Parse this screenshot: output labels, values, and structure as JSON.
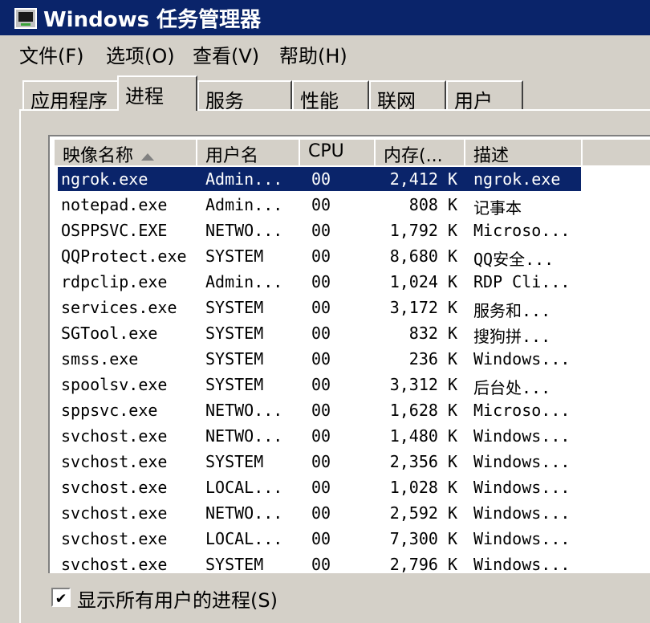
{
  "window": {
    "title": "Windows 任务管理器",
    "icon": "task-manager-icon"
  },
  "menu": [
    "文件(F)",
    "选项(O)",
    "查看(V)",
    "帮助(H)"
  ],
  "tabs": [
    {
      "label": "应用程序",
      "active": false
    },
    {
      "label": "进程",
      "active": true
    },
    {
      "label": "服务",
      "active": false
    },
    {
      "label": "性能",
      "active": false
    },
    {
      "label": "联网",
      "active": false
    },
    {
      "label": "用户",
      "active": false
    }
  ],
  "columns": [
    "映像名称",
    "用户名",
    "CPU",
    "内存(...",
    "描述"
  ],
  "sort_column": "映像名称",
  "processes": [
    {
      "name": "ngrok.exe",
      "user": "Admin...",
      "cpu": "00",
      "mem": "2,412 K",
      "desc": "ngrok.exe",
      "selected": true
    },
    {
      "name": "notepad.exe",
      "user": "Admin...",
      "cpu": "00",
      "mem": "808 K",
      "desc": "记事本"
    },
    {
      "name": "OSPPSVC.EXE",
      "user": "NETWO...",
      "cpu": "00",
      "mem": "1,792 K",
      "desc": "Microso..."
    },
    {
      "name": "QQProtect.exe",
      "user": "SYSTEM",
      "cpu": "00",
      "mem": "8,680 K",
      "desc": "QQ安全..."
    },
    {
      "name": "rdpclip.exe",
      "user": "Admin...",
      "cpu": "00",
      "mem": "1,024 K",
      "desc": "RDP Cli..."
    },
    {
      "name": "services.exe",
      "user": "SYSTEM",
      "cpu": "00",
      "mem": "3,172 K",
      "desc": "服务和..."
    },
    {
      "name": "SGTool.exe",
      "user": "SYSTEM",
      "cpu": "00",
      "mem": "832 K",
      "desc": "搜狗拼..."
    },
    {
      "name": "smss.exe",
      "user": "SYSTEM",
      "cpu": "00",
      "mem": "236 K",
      "desc": "Windows..."
    },
    {
      "name": "spoolsv.exe",
      "user": "SYSTEM",
      "cpu": "00",
      "mem": "3,312 K",
      "desc": "后台处..."
    },
    {
      "name": "sppsvc.exe",
      "user": "NETWO...",
      "cpu": "00",
      "mem": "1,628 K",
      "desc": "Microso..."
    },
    {
      "name": "svchost.exe",
      "user": "NETWO...",
      "cpu": "00",
      "mem": "1,480 K",
      "desc": "Windows..."
    },
    {
      "name": "svchost.exe",
      "user": "SYSTEM",
      "cpu": "00",
      "mem": "2,356 K",
      "desc": "Windows..."
    },
    {
      "name": "svchost.exe",
      "user": "LOCAL...",
      "cpu": "00",
      "mem": "1,028 K",
      "desc": "Windows..."
    },
    {
      "name": "svchost.exe",
      "user": "NETWO...",
      "cpu": "00",
      "mem": "2,592 K",
      "desc": "Windows..."
    },
    {
      "name": "svchost.exe",
      "user": "LOCAL...",
      "cpu": "00",
      "mem": "7,300 K",
      "desc": "Windows..."
    },
    {
      "name": "svchost.exe",
      "user": "SYSTEM",
      "cpu": "00",
      "mem": "2,796 K",
      "desc": "Windows..."
    }
  ],
  "show_all_users": {
    "label": "显示所有用户的进程(S)",
    "checked": true,
    "mark": "✔"
  }
}
